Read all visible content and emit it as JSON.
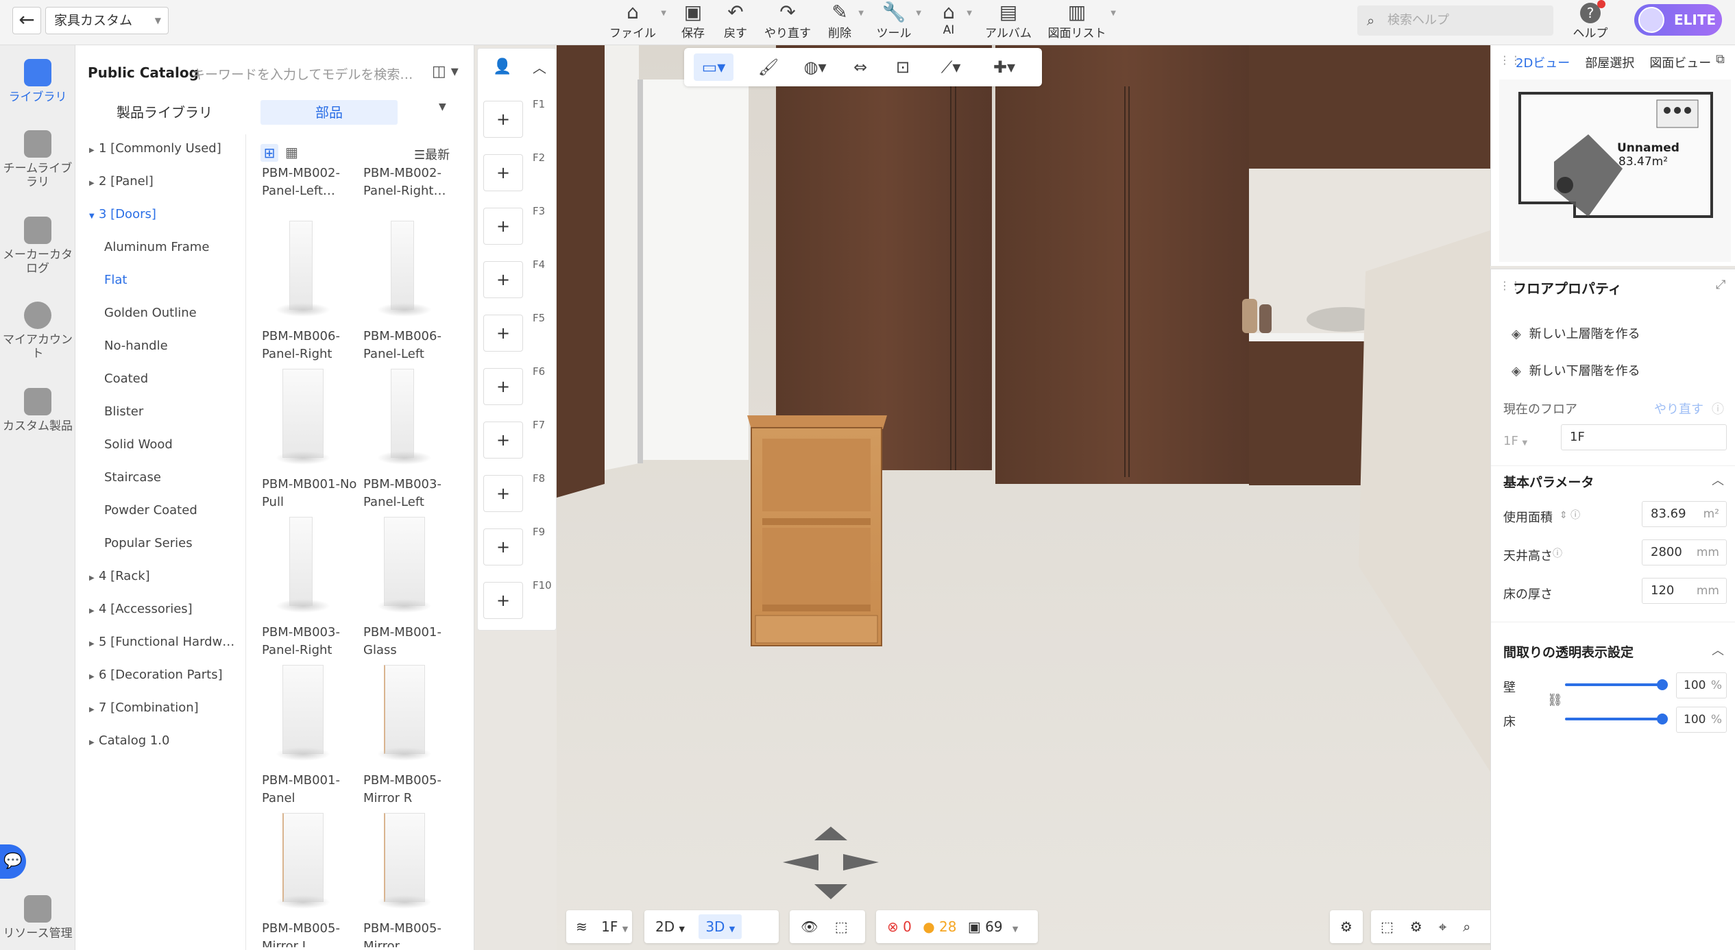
{
  "topbar": {
    "project_name": "家具カスタム",
    "menu": [
      {
        "label": "ファイル",
        "icon": "file-icon"
      },
      {
        "label": "保存",
        "icon": "save-icon"
      },
      {
        "label": "戻す",
        "icon": "undo-icon"
      },
      {
        "label": "やり直す",
        "icon": "redo-icon"
      },
      {
        "label": "削除",
        "icon": "eraser-icon"
      },
      {
        "label": "ツール",
        "icon": "wrench-icon"
      },
      {
        "label": "AI",
        "icon": "ai-icon"
      },
      {
        "label": "アルバム",
        "icon": "album-icon"
      },
      {
        "label": "図面リスト",
        "icon": "drawing-list-icon"
      }
    ],
    "search_placeholder": "検索ヘルプ",
    "help_label": "ヘルプ",
    "plan_badge": "ELITE"
  },
  "leftnav": [
    {
      "label": "ライブラリ",
      "active": true
    },
    {
      "label": "チームライブラリ",
      "active": false
    },
    {
      "label": "メーカーカタログ",
      "active": false
    },
    {
      "label": "マイアカウント",
      "active": false
    },
    {
      "label": "カスタム製品",
      "active": false
    },
    {
      "label": "リソース管理",
      "active": false
    }
  ],
  "catalog": {
    "title": "Public Catalog",
    "search_placeholder": "キーワードを入力してモデルを検索…",
    "tab_products": "製品ライブラリ",
    "tab_parts": "部品",
    "sort_label": "最新",
    "tree": [
      "1 [Commonly Used]",
      "2 [Panel]",
      "3 [Doors]",
      "4 [Rack]",
      "4 [Accessories]",
      "5 [Functional Hardw…",
      "6 [Decoration Parts]",
      "7 [Combination]",
      "Catalog 1.0"
    ],
    "doors_sub": [
      "Aluminum Frame",
      "Flat",
      "Golden Outline",
      "No-handle",
      "Coated",
      "Blister",
      "Solid Wood",
      "Staircase",
      "Powder Coated",
      "Popular Series"
    ],
    "products": [
      {
        "name": "PBM-MB002-Panel-Left…"
      },
      {
        "name": "PBM-MB002-Panel-Right…"
      },
      {
        "name": "PBM-MB006-Panel-Right"
      },
      {
        "name": "PBM-MB006-Panel-Left"
      },
      {
        "name": "PBM-MB001-No Pull"
      },
      {
        "name": "PBM-MB003-Panel-Left"
      },
      {
        "name": "PBM-MB003-Panel-Right"
      },
      {
        "name": "PBM-MB001-Glass"
      },
      {
        "name": "PBM-MB001-Panel"
      },
      {
        "name": "PBM-MB005-Mirror R"
      },
      {
        "name": "PBM-MB005-Mirror L"
      },
      {
        "name": "PBM-MB005-Mirror"
      }
    ]
  },
  "floors": [
    "F1",
    "F2",
    "F3",
    "F4",
    "F5",
    "F6",
    "F7",
    "F8",
    "F9",
    "F10"
  ],
  "viewport_bottom": {
    "floor": "1F",
    "mode_2d": "2D",
    "mode_3d": "3D",
    "errors": "0",
    "warnings": "28",
    "items": "69"
  },
  "minimap": {
    "tabs": [
      "2Dビュー",
      "部屋選択",
      "図面ビュー"
    ],
    "room_name": "Unnamed",
    "room_area": "83.47m²"
  },
  "props": {
    "title": "フロアプロパティ",
    "new_upper": "新しい上層階を作る",
    "new_lower": "新しい下層階を作る",
    "current_floor_label": "現在のフロア",
    "redo_label": "やり直す",
    "floor_select": "1F",
    "floor_name": "1F",
    "basic_title": "基本パラメータ",
    "area_label": "使用面積",
    "area_value": "83.69",
    "area_unit": "m²",
    "height_label": "天井高さ",
    "height_value": "2800",
    "height_unit": "mm",
    "thickness_label": "床の厚さ",
    "thickness_value": "120",
    "thickness_unit": "mm",
    "transparency_title": "間取りの透明表示設定",
    "wall_label": "壁",
    "wall_value": "100",
    "floor_label": "床",
    "floor_value": "100",
    "percent": "%"
  }
}
